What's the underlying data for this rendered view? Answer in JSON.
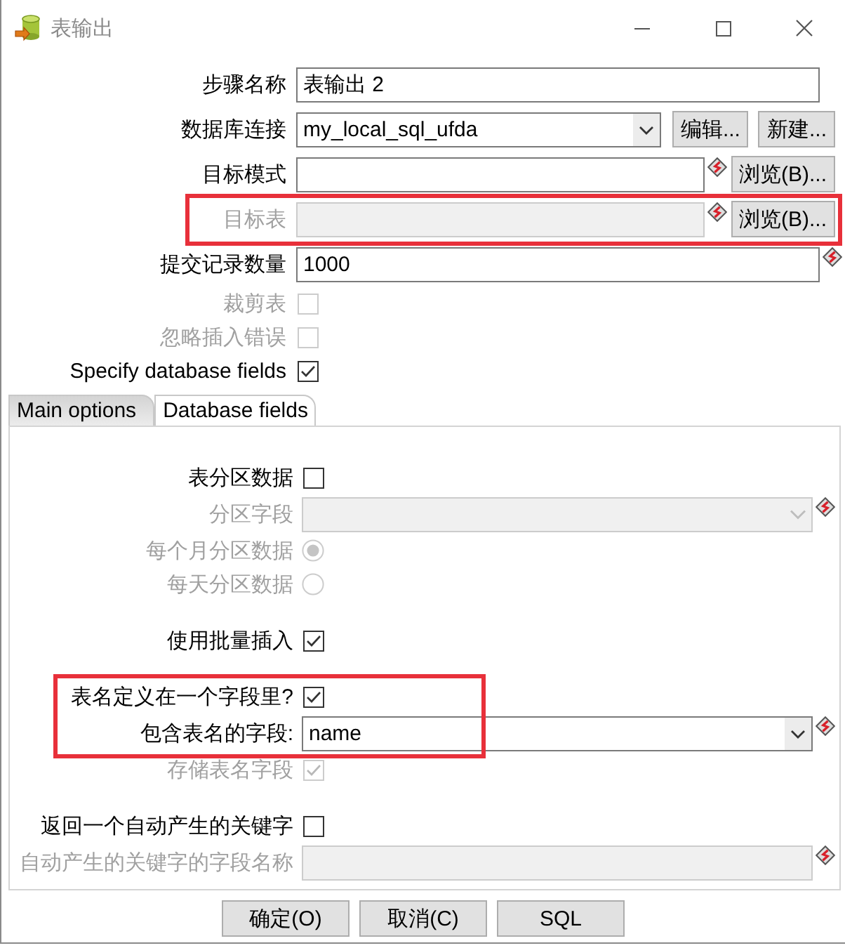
{
  "window": {
    "title": "表输出"
  },
  "fields": [
    {
      "kind": "text",
      "label": "步骤名称",
      "value": "表输出 2",
      "disabled": false,
      "variable": false,
      "highlighted": false
    },
    {
      "kind": "combo",
      "label": "数据库连接",
      "value": "my_local_sql_ufda",
      "disabled": false,
      "variable": false,
      "highlighted": false,
      "buttons": [
        "编辑...",
        "新建..."
      ]
    },
    {
      "kind": "text",
      "label": "目标模式",
      "disabled": false,
      "variable": true,
      "highlighted": false,
      "buttons": [
        "浏览(B)..."
      ]
    },
    {
      "kind": "text",
      "label": "目标表",
      "disabled": true,
      "variable": true,
      "highlighted": true,
      "buttons": [
        "浏览(B)..."
      ]
    },
    {
      "kind": "text",
      "label": "提交记录数量",
      "value": "1000",
      "disabled": false,
      "variable": true,
      "highlighted": false
    },
    {
      "kind": "checkbox",
      "label": "裁剪表",
      "checked": false,
      "disabled": true,
      "highlighted": false
    },
    {
      "kind": "checkbox",
      "label": "忽略插入错误",
      "checked": false,
      "disabled": true,
      "highlighted": false
    },
    {
      "kind": "checkbox",
      "label": "Specify database fields",
      "checked": true,
      "disabled": false,
      "highlighted": false
    }
  ],
  "tabs": [
    {
      "label": "Main options",
      "selected": true
    },
    {
      "label": "Database fields",
      "selected": false
    }
  ],
  "main_options": {
    "groups": [
      {
        "rows": [
          {
            "kind": "checkbox",
            "label": "表分区数据",
            "checked": false,
            "disabled": false,
            "highlighted": false
          },
          {
            "kind": "combo",
            "label": "分区字段",
            "disabled": true,
            "variable": true,
            "highlighted": false
          },
          {
            "kind": "radio",
            "label": "每个月分区数据",
            "selected": true,
            "disabled": true,
            "highlighted": false
          },
          {
            "kind": "radio",
            "label": "每天分区数据",
            "selected": false,
            "disabled": true,
            "highlighted": false
          }
        ]
      },
      {
        "rows": [
          {
            "kind": "checkbox",
            "label": "使用批量插入",
            "checked": true,
            "disabled": false,
            "highlighted": false
          }
        ]
      },
      {
        "rows": [
          {
            "kind": "checkbox",
            "label": "表名定义在一个字段里?",
            "checked": true,
            "disabled": false,
            "highlighted": true
          },
          {
            "kind": "combo",
            "label": "包含表名的字段:",
            "value": "name",
            "disabled": false,
            "variable": true,
            "highlighted": true
          },
          {
            "kind": "checkbox",
            "label": "存储表名字段",
            "checked": true,
            "disabled": true,
            "highlighted": false
          }
        ]
      },
      {
        "rows": [
          {
            "kind": "checkbox",
            "label": "返回一个自动产生的关键字",
            "checked": false,
            "disabled": false,
            "highlighted": false
          },
          {
            "kind": "text",
            "label": "自动产生的关键字的字段名称",
            "disabled": true,
            "variable": true,
            "highlighted": false
          }
        ]
      }
    ]
  },
  "buttons": [
    "确定(O)",
    "取消(C)",
    "SQL"
  ]
}
